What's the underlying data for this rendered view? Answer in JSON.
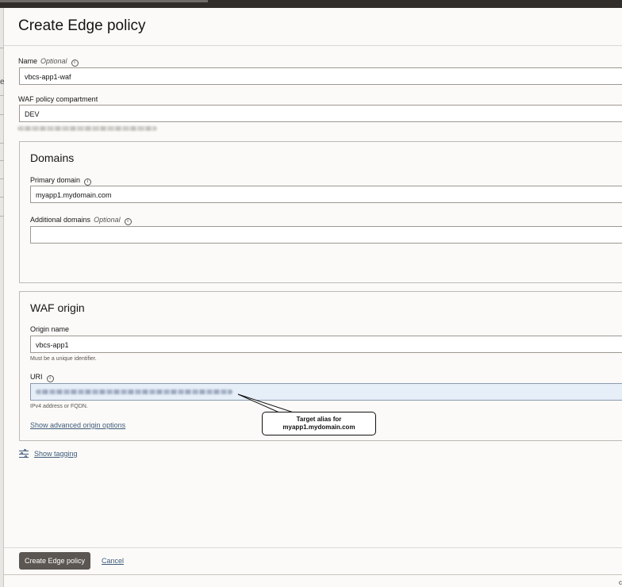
{
  "header": {
    "title": "Create Edge policy"
  },
  "name_field": {
    "label": "Name",
    "optional": "Optional",
    "value": "vbcs-app1-waf"
  },
  "compartment_field": {
    "label": "WAF policy compartment",
    "value": "DEV"
  },
  "domains": {
    "title": "Domains",
    "primary": {
      "label": "Primary domain",
      "value": "myapp1.mydomain.com"
    },
    "additional": {
      "label": "Additional domains",
      "optional": "Optional",
      "value": ""
    }
  },
  "waf_origin": {
    "title": "WAF origin",
    "origin_name": {
      "label": "Origin name",
      "value": "vbcs-app1",
      "hint": "Must be a unique identifier."
    },
    "uri": {
      "label": "URI",
      "hint": "IPv4 address or FQDN."
    },
    "advanced_link": "Show advanced origin options"
  },
  "tagging": {
    "link": "Show tagging",
    "icon": "sliders-icon"
  },
  "footer": {
    "create_label": "Create Edge policy",
    "cancel_label": "Cancel"
  },
  "annotation": {
    "line1": "Target alias for",
    "line2": "myapp1.mydomain.com"
  },
  "misc": {
    "left_glyph": "e",
    "corner_glyph": "c"
  },
  "colors": {
    "primary_button": "#5b5652",
    "link": "#3f5b7a",
    "topbar": "#312d2a"
  }
}
